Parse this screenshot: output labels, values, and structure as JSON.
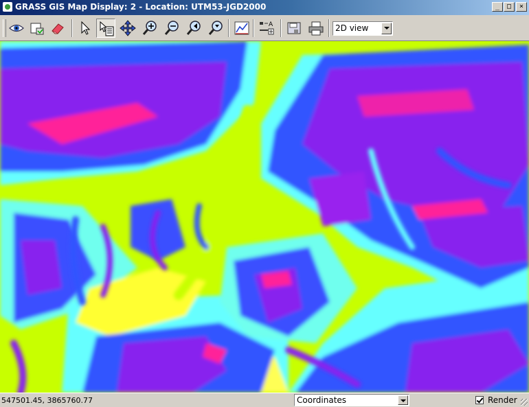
{
  "window": {
    "title": "GRASS GIS Map Display: 2 - Location: UTM53-JGD2000",
    "minimize_glyph": "_",
    "maximize_glyph": "□",
    "close_glyph": "×"
  },
  "toolbar": {
    "tools": [
      "eye-icon",
      "overlay-icon",
      "erase-icon",
      "pointer-icon",
      "query-icon",
      "pan-icon",
      "zoom-in-icon",
      "zoom-out-icon",
      "zoom-back-icon",
      "zoom-menu-icon",
      "analyze-icon",
      "legend-icon",
      "save-icon",
      "print-icon"
    ],
    "active_tool": "query-icon",
    "view_select": "2D view"
  },
  "map": {
    "colors": [
      "#c8ff00",
      "#ffff33",
      "#66ffff",
      "#3355ff",
      "#8822ee",
      "#ff2299"
    ]
  },
  "status": {
    "coordinates": "547501.45, 3865760.77",
    "mode_select": "Coordinates",
    "render_label": "Render",
    "render_checked": true
  }
}
